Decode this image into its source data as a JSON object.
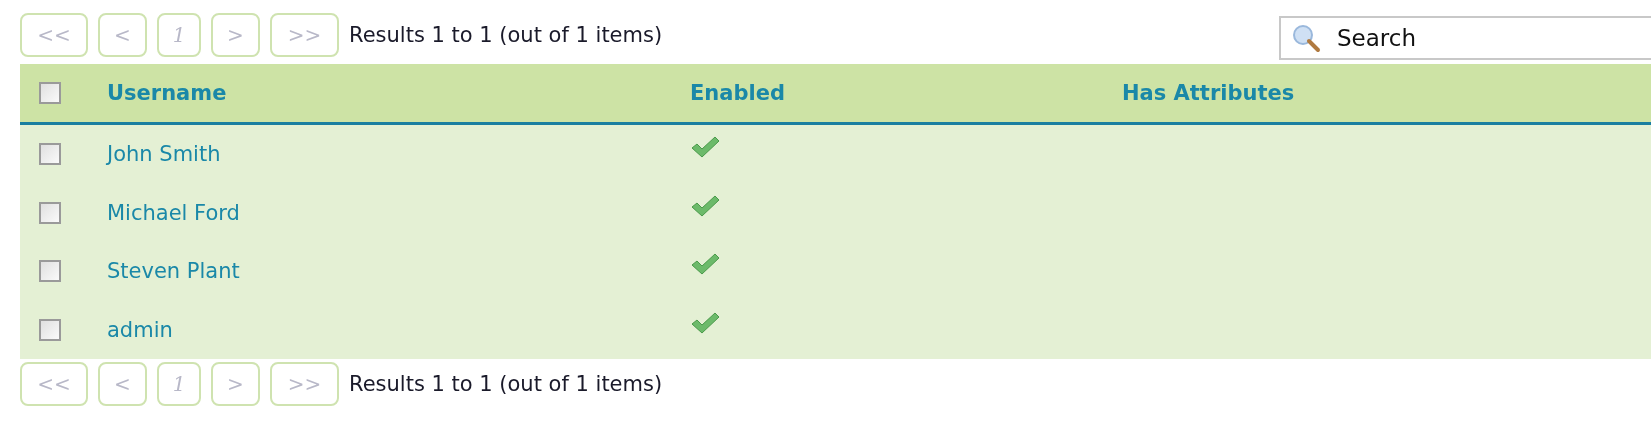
{
  "top_pager": {
    "buttons": [
      "<<",
      "<",
      "1",
      ">",
      ">>"
    ],
    "summary": "Results 1 to 1 (out of 1 items)"
  },
  "search": {
    "placeholder": "Search"
  },
  "table": {
    "select_all": {
      "checked": false
    },
    "columns": [
      "Username",
      "Enabled",
      "Has Attributes"
    ],
    "rows": [
      {
        "checked": false,
        "username": "John Smith",
        "enabled": true
      },
      {
        "checked": false,
        "username": "Michael Ford",
        "enabled": true
      },
      {
        "checked": false,
        "username": "Steven Plant",
        "enabled": true
      },
      {
        "checked": false,
        "username": "admin",
        "enabled": true
      }
    ]
  },
  "bottom_pager": {
    "buttons": [
      "<<",
      "<",
      "1",
      ">",
      ">>"
    ],
    "summary": "Results 1 to 1 (out of 1 items)"
  }
}
